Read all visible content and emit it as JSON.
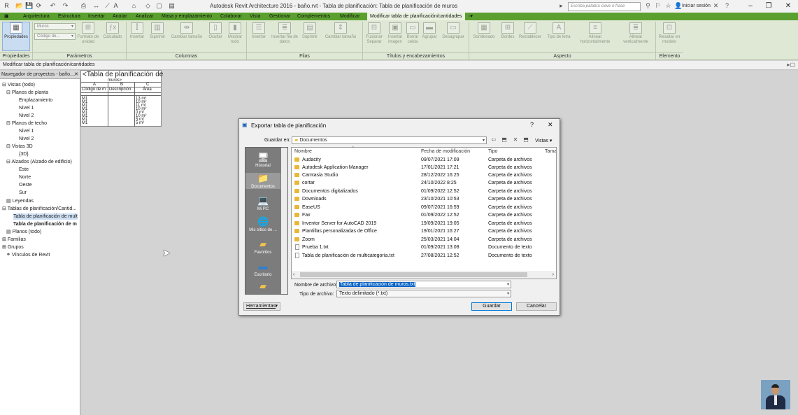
{
  "titlebar": {
    "title": "Autodesk Revit Architecture 2016 -    baño.rvt - Tabla de planificación: Tabla de planificación de muros",
    "search_placeholder": "Escriba palabra clave o frase",
    "login": "Iniciar sesión"
  },
  "tabs": [
    "Arquitectura",
    "Estructura",
    "Insertar",
    "Anotar",
    "Analizar",
    "Masa y emplazamiento",
    "Colaborar",
    "Vista",
    "Gestionar",
    "Complementos",
    "Modificar",
    "Modificar tabla de planificación/cantidades"
  ],
  "ribbon": {
    "properties_label": "Propiedades",
    "param_select_1": "Muros",
    "param_select_2": "Código de...",
    "buttons": {
      "formato_unidad": "Formato de unidad",
      "calculado": "Calculado",
      "insertar_col": "Insertar",
      "suprimir_col": "Suprimir",
      "cambiar_tam_col": "Cambiar tamaño",
      "ocultar": "Ocultar",
      "mostrar_todo": "Mostrar todo",
      "insertar_fila": "Insertar",
      "insertar_fila_datos": "Insertar fila de datos",
      "suprimir_fila": "Suprimir",
      "cambiar_tam_fila": "Cambiar tamaño",
      "fusionar": "Fusionar Separar",
      "insertar_imagen": "Insertar imagen",
      "borrar_celda": "Borrar celda",
      "agrupar": "Agrupar",
      "desagrupar": "Desagrupar",
      "sombreado": "Sombreado",
      "bordes": "Bordes",
      "restablecer": "Restablecer",
      "tipo_letra": "Tipo de letra",
      "alinear_h": "Alinear horizontalmente",
      "alinear_v": "Alinear verticalmente",
      "resaltar": "Resaltar en modelo"
    },
    "groups": {
      "propiedades": "Propiedades",
      "parametros": "Parámetros",
      "columnas": "Columnas",
      "filas": "Filas",
      "titulos": "Títulos y encabezamientos",
      "aspecto": "Aspecto",
      "elemento": "Elemento"
    }
  },
  "optbar": "Modificar tabla de planificación/cantidades",
  "project_browser": {
    "header": "Navegador de proyectos - baño....",
    "items": [
      "Vistas (todo)",
      "Planos de planta",
      "Emplazamiento",
      "Nivel 1",
      "Nivel 2",
      "Planos de techo",
      "Nivel 1",
      "Nivel 2",
      "Vistas 3D",
      "{3D}",
      "Alzados (Alzado de edificio)",
      "Este",
      "Norte",
      "Oeste",
      "Sur",
      "Leyendas",
      "Tablas de planificación/Cantid...",
      "Tabla de planificación de mult",
      "Tabla de planificación de m",
      "Planos (todo)",
      "Familias",
      "Grupos",
      "Vínculos de Revit"
    ]
  },
  "schedule": {
    "title": "<Tabla de planificación de",
    "title_cont": "muros>",
    "col_letters": [
      "A",
      "B",
      "C"
    ],
    "col_headers": [
      "Código de m",
      "Descripción",
      "Área"
    ],
    "rows": [
      [
        "M1",
        "",
        "13 m²"
      ],
      [
        "M1",
        "",
        "10 m²"
      ],
      [
        "M1",
        "",
        "11 m²"
      ],
      [
        "M1",
        "",
        "10 m²"
      ],
      [
        "M1",
        "",
        "0 m²"
      ],
      [
        "M1",
        "",
        "10 m²"
      ],
      [
        "M1",
        "",
        "5 m²"
      ],
      [
        "M1",
        "",
        "5 m²"
      ]
    ]
  },
  "dialog": {
    "title": "Exportar tabla de planificación",
    "help": "?",
    "close": "✕",
    "save_in_label": "Guardar en:",
    "save_in_value": "Documentos",
    "views_label": "Vistas",
    "places": [
      "Historial",
      "Documentos",
      "Mi PC",
      "Mis sitios de ...",
      "Favoritos",
      "Escritorio",
      ""
    ],
    "columns": [
      "Nombre",
      "Fecha de modificación",
      "Tipo",
      "Tamaño"
    ],
    "files": [
      {
        "name": "Audacity",
        "date": "09/07/2021 17:09",
        "type": "Carpeta de archivos",
        "kind": "folder"
      },
      {
        "name": "Autodesk Application Manager",
        "date": "17/01/2021 17:21",
        "type": "Carpeta de archivos",
        "kind": "folder"
      },
      {
        "name": "Camtasia Studio",
        "date": "28/12/2022 16:25",
        "type": "Carpeta de archivos",
        "kind": "folder"
      },
      {
        "name": "cortar",
        "date": "24/10/2022 8:25",
        "type": "Carpeta de archivos",
        "kind": "folder"
      },
      {
        "name": "Documentos digitalizados",
        "date": "01/09/2022 12:52",
        "type": "Carpeta de archivos",
        "kind": "folder"
      },
      {
        "name": "Downloads",
        "date": "23/10/2021 10:53",
        "type": "Carpeta de archivos",
        "kind": "folder"
      },
      {
        "name": "EaseUS",
        "date": "09/07/2021 16:59",
        "type": "Carpeta de archivos",
        "kind": "folder"
      },
      {
        "name": "Fax",
        "date": "01/09/2022 12:52",
        "type": "Carpeta de archivos",
        "kind": "folder"
      },
      {
        "name": "Inventor Server for AutoCAD 2019",
        "date": "19/09/2021 19:05",
        "type": "Carpeta de archivos",
        "kind": "folder"
      },
      {
        "name": "Plantillas personalizadas de Office",
        "date": "19/01/2021 16:27",
        "type": "Carpeta de archivos",
        "kind": "folder"
      },
      {
        "name": "Zoom",
        "date": "25/03/2021 14:04",
        "type": "Carpeta de archivos",
        "kind": "folder"
      },
      {
        "name": "Prueba 1.txt",
        "date": "01/09/2021 13:08",
        "type": "Documento de texto",
        "kind": "text"
      },
      {
        "name": "Tabla de planificación de multicategoría.txt",
        "date": "27/08/2021 12:52",
        "type": "Documento de texto",
        "kind": "text"
      }
    ],
    "filename_label": "Nombre de archivo:",
    "filename_value": "Tabla de planificación de muros.txt",
    "filetype_label": "Tipo de archivo:",
    "filetype_value": "Texto delimitado  (*.txt)",
    "tools_label": "Herramientas",
    "save_button": "Guardar",
    "cancel_button": "Cancelar"
  }
}
